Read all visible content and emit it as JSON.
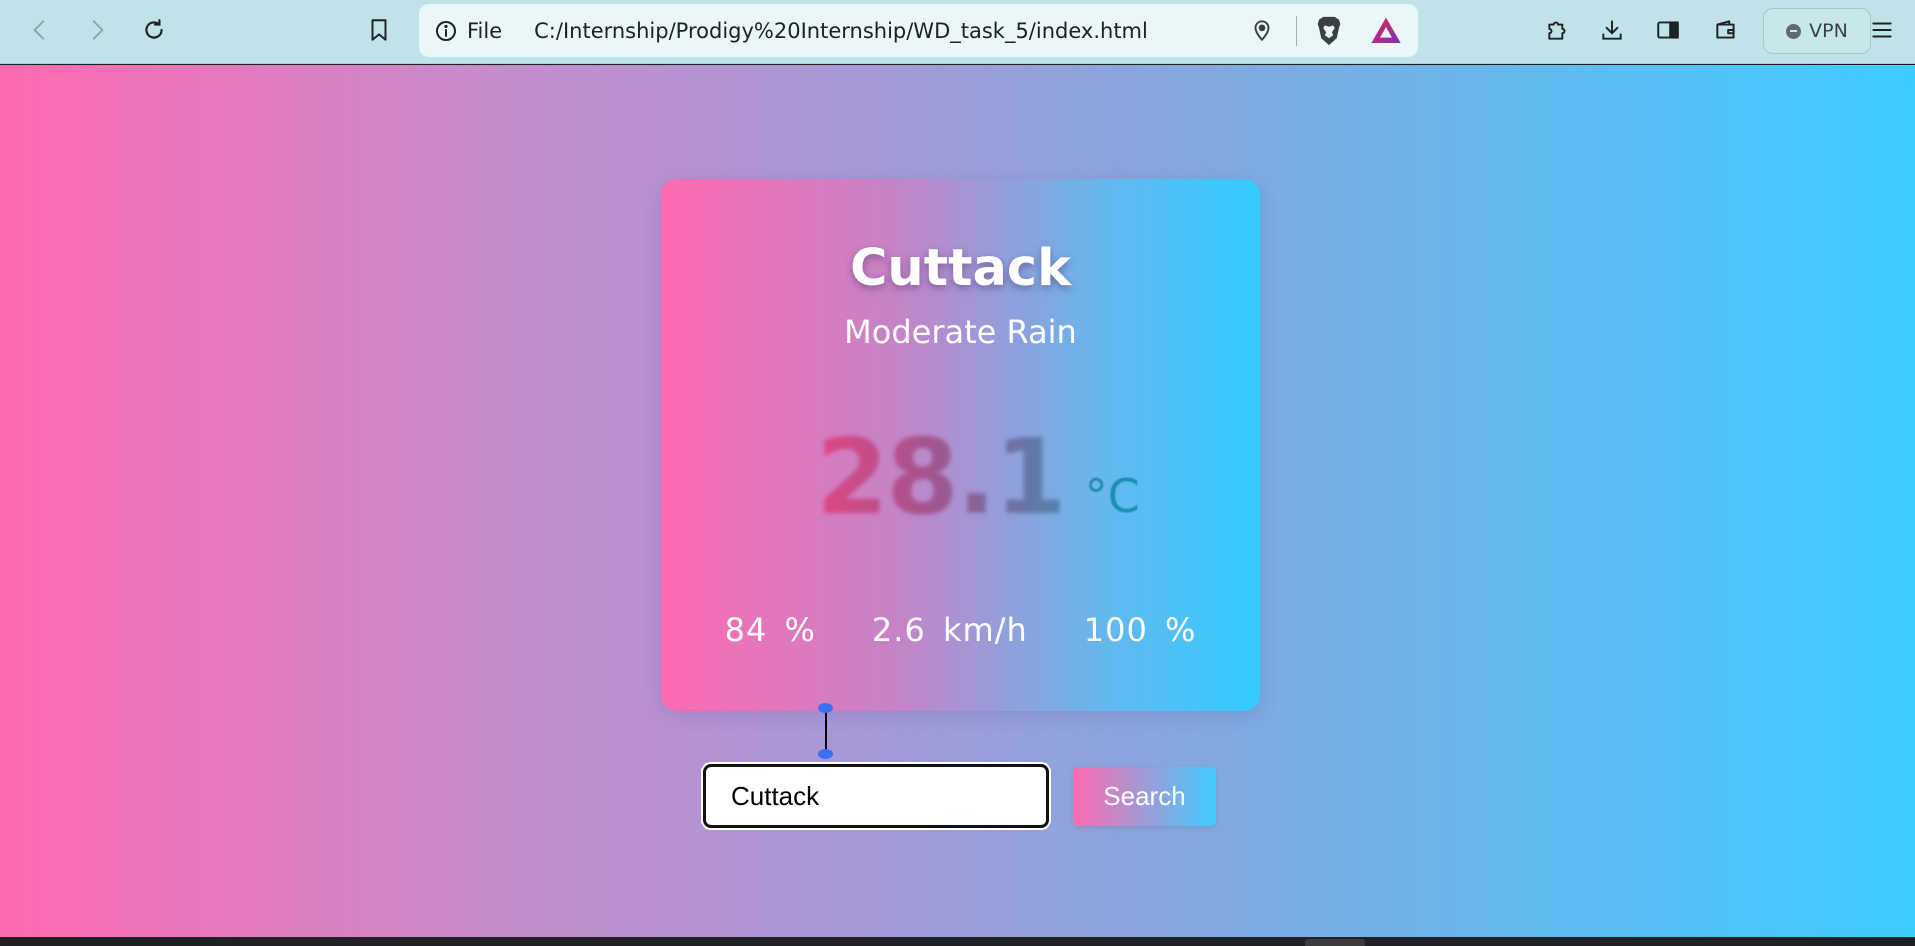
{
  "browser": {
    "url_scheme_label": "File",
    "url": "C:/Internship/Prodigy%20Internship/WD_task_5/index.html",
    "vpn_label": "VPN"
  },
  "weather": {
    "city": "Cuttack",
    "condition": "Moderate Rain",
    "temperature": "28.1",
    "unit": "°C",
    "humidity": "84 %",
    "wind": "2.6 km/h",
    "clouds": "100 %"
  },
  "search": {
    "value": "Cuttack",
    "button_label": "Search"
  },
  "colors": {
    "gradient_start": "#ff6aae",
    "gradient_end": "#3ecdff",
    "toolbar": "#bfe3e6"
  }
}
